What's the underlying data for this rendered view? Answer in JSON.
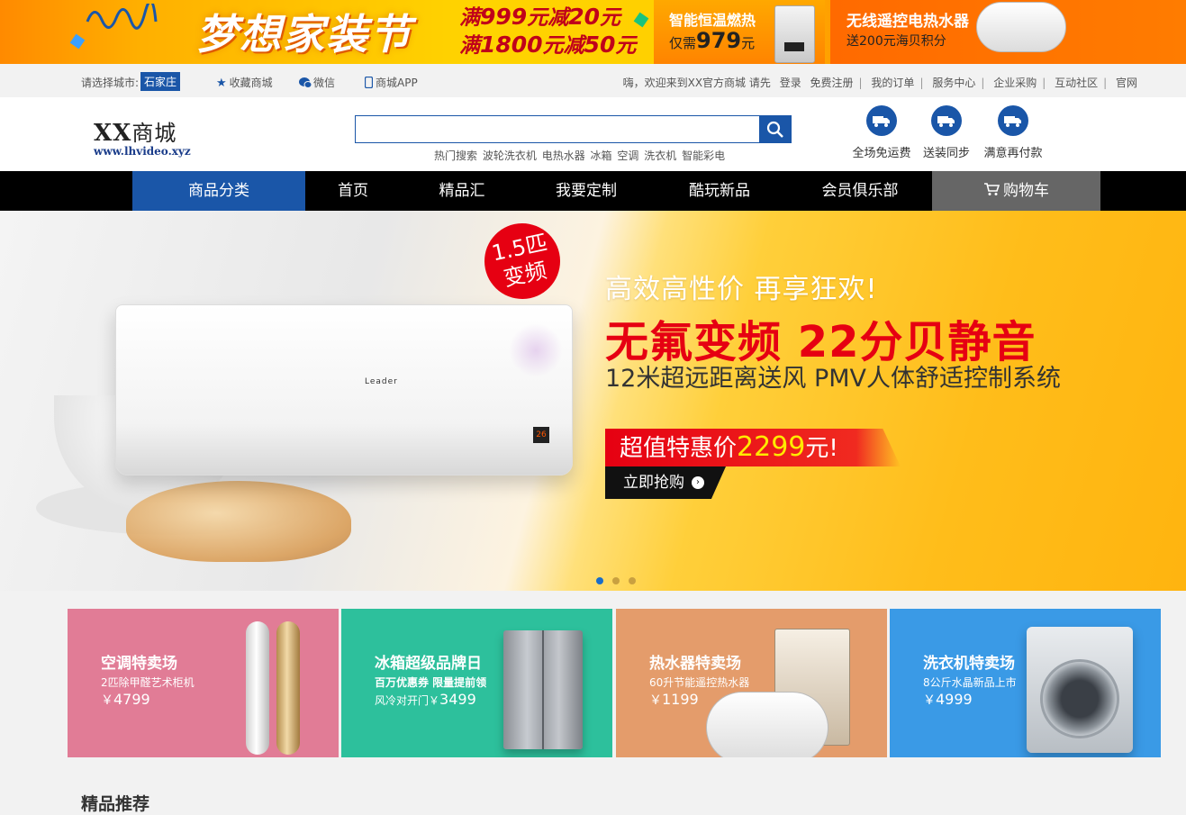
{
  "promo": {
    "title": "梦想家装节",
    "deal_line1_pre": "满",
    "deal_line1_amt": "999",
    "deal_line1_mid": "元减",
    "deal_line1_off": "20",
    "deal_line1_end": "元",
    "deal_line2_pre": "满",
    "deal_line2_amt": "1800",
    "deal_line2_mid": "元减",
    "deal_line2_off": "50",
    "deal_line2_end": "元",
    "gas_title": "智能恒温燃热",
    "gas_price_pre": "仅需",
    "gas_price": "979",
    "gas_price_unit": "元",
    "heater_title": "无线遥控电热水器",
    "heater_sub": "送200元海贝积分"
  },
  "topbar": {
    "city_label": "请选择城市:",
    "city": "石家庄",
    "favorite": "收藏商城",
    "wechat": "微信",
    "app": "商城APP",
    "welcome": "嗨，欢迎来到XX官方商城 请先",
    "links": [
      "登录",
      "免费注册",
      "我的订单",
      "服务中心",
      "企业采购",
      "互动社区",
      "官网"
    ]
  },
  "header": {
    "logo_main": "XX",
    "logo_cn": "商城",
    "logo_url": "www.lhvideo.xyz",
    "search_value": "",
    "hot_label": "热门搜索",
    "hot_items": [
      "波轮洗衣机",
      "电热水器",
      "冰箱",
      "空调",
      "洗衣机",
      "智能彩电"
    ],
    "services": [
      "全场免运费",
      "送装同步",
      "满意再付款"
    ]
  },
  "nav": {
    "items": [
      "商品分类",
      "首页",
      "精品汇",
      "我要定制",
      "酷玩新品",
      "会员俱乐部"
    ],
    "cart": "购物车"
  },
  "hero": {
    "badge_line1": "1.5匹",
    "badge_line2": "变频",
    "line1": "高效高性价 再享狂欢!",
    "line2": "无氟变频 22分贝静音",
    "line3": "12米超远距离送风 PMV人体舒适控制系统",
    "price_pre": "超值特惠价",
    "price": "2299",
    "price_post": "元!",
    "buy": "立即抢购",
    "ac_brand": "Leader",
    "ac_display": "26",
    "slides": 3,
    "active_slide": 1
  },
  "cards": [
    {
      "title": "空调特卖场",
      "sub": "2匹除甲醛艺术柜机",
      "price_symbol": "￥",
      "price": "4799",
      "color": "#e17c96"
    },
    {
      "title": "冰箱超级品牌日",
      "sub": "百万优惠券  限量提前领",
      "price_pre": "风冷对开门",
      "price_symbol": "￥",
      "price": "3499",
      "color": "#2dc09c"
    },
    {
      "title": "热水器特卖场",
      "sub": "60升节能遥控热水器",
      "price_symbol": "￥",
      "price": "1199",
      "color": "#e49c6b"
    },
    {
      "title": "洗衣机特卖场",
      "sub": "8公斤水晶新品上市",
      "price_symbol": "￥",
      "price": "4999",
      "color": "#3a9ae6"
    }
  ],
  "section": {
    "title": "精品推荐"
  },
  "colors": {
    "primary": "#1a56a8",
    "accent_red": "#e60012",
    "nav_bg": "#000000",
    "cart_bg": "#666666"
  }
}
